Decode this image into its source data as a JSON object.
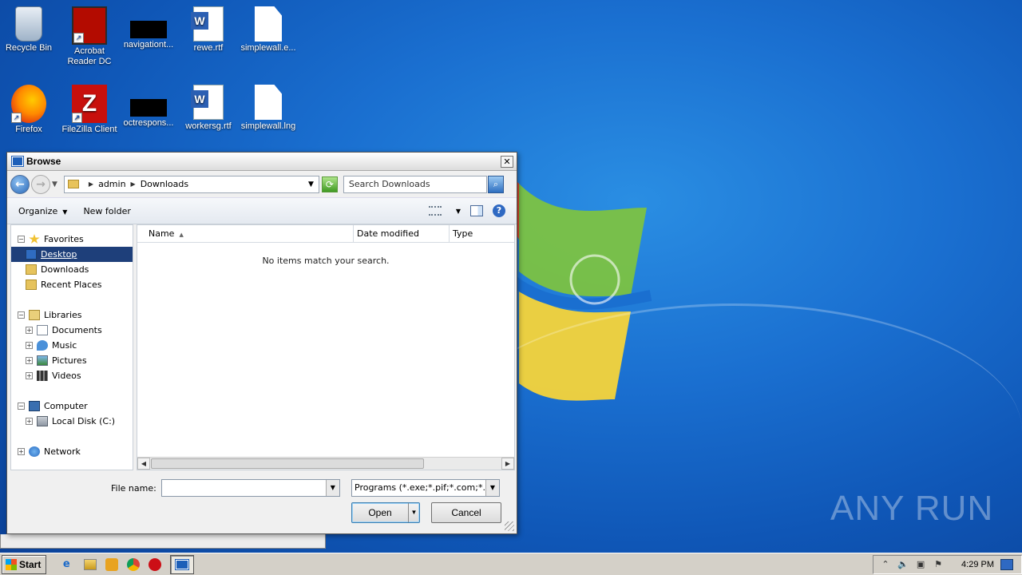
{
  "desktop": {
    "icons": [
      {
        "label": "Recycle Bin",
        "icon": "recycle-bin-icon"
      },
      {
        "label": "Acrobat Reader DC",
        "icon": "acrobat-reader-icon"
      },
      {
        "label": "navigationt...",
        "icon": "black-file-icon"
      },
      {
        "label": "rewe.rtf",
        "icon": "word-document-icon"
      },
      {
        "label": "simplewall.e...",
        "icon": "blank-file-icon"
      },
      {
        "label": "Firefox",
        "icon": "firefox-icon"
      },
      {
        "label": "FileZilla Client",
        "icon": "filezilla-icon"
      },
      {
        "label": "octrespons...",
        "icon": "black-file-icon"
      },
      {
        "label": "workersg.rtf",
        "icon": "word-document-icon"
      },
      {
        "label": "simplewall.lng",
        "icon": "blank-file-icon"
      }
    ],
    "watermark": "ANY RUN"
  },
  "dialog": {
    "title": "Browse",
    "close_label": "✕",
    "breadcrumb": [
      "admin",
      "Downloads"
    ],
    "search_placeholder": "Search Downloads",
    "toolbar": {
      "organize": "Organize",
      "new_folder": "New folder",
      "help": "?"
    },
    "tree": {
      "favorites": "Favorites",
      "desktop": "Desktop",
      "downloads": "Downloads",
      "recent_places": "Recent Places",
      "libraries": "Libraries",
      "documents": "Documents",
      "music": "Music",
      "pictures": "Pictures",
      "videos": "Videos",
      "computer": "Computer",
      "local_disk": "Local Disk (C:)",
      "network": "Network",
      "selected": "Desktop"
    },
    "columns": {
      "name": "Name",
      "date_modified": "Date modified",
      "type": "Type"
    },
    "empty_message": "No items match your search.",
    "file_name_label": "File name:",
    "file_name_value": "",
    "file_type_filter": "Programs (*.exe;*.pif;*.com;*.ba",
    "open_label": "Open",
    "cancel_label": "Cancel"
  },
  "taskbar": {
    "start_label": "Start",
    "pinned": [
      "internet-explorer-icon",
      "explorer-icon",
      "media-player-icon",
      "chrome-icon",
      "opera-icon",
      "browse-window-icon"
    ],
    "clock": "4:29 PM"
  },
  "colors": {
    "desktop_blue": "#1a6fd0",
    "selection": "#1e3f7a",
    "taskbar": "#d4d0c8"
  }
}
